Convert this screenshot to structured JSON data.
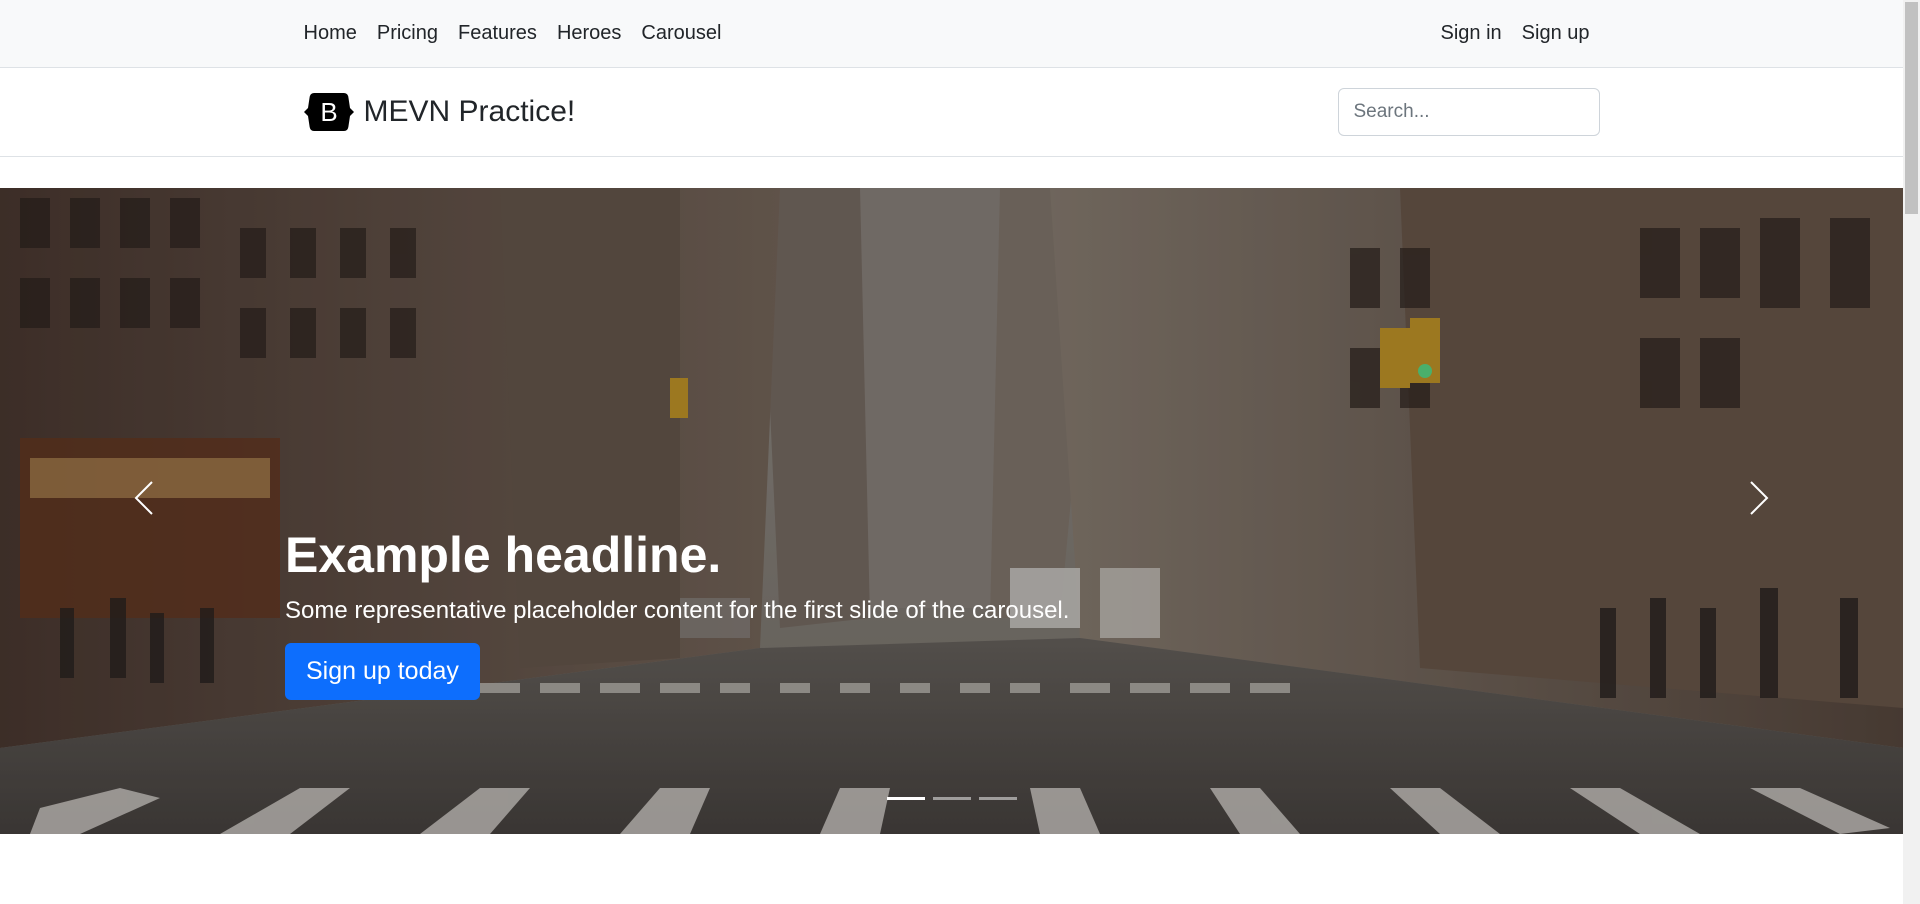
{
  "topnav": {
    "left_links": [
      {
        "label": "Home"
      },
      {
        "label": "Pricing"
      },
      {
        "label": "Features"
      },
      {
        "label": "Heroes"
      },
      {
        "label": "Carousel"
      }
    ],
    "right_links": [
      {
        "label": "Sign in"
      },
      {
        "label": "Sign up"
      }
    ]
  },
  "header": {
    "logo_letter": "B",
    "brand_name": "MEVN Practice!",
    "search": {
      "placeholder": "Search...",
      "value": ""
    }
  },
  "carousel": {
    "slide": {
      "title": "Example headline.",
      "text": "Some representative placeholder content for the first slide of the carousel.",
      "button_label": "Sign up today"
    },
    "indicators_count": 3,
    "active_index": 0,
    "icons": {
      "prev": "chevron-left-icon",
      "next": "chevron-right-icon"
    }
  },
  "colors": {
    "primary": "#0d6efd",
    "topnav_bg": "#f8f9fa",
    "text": "#212529"
  }
}
